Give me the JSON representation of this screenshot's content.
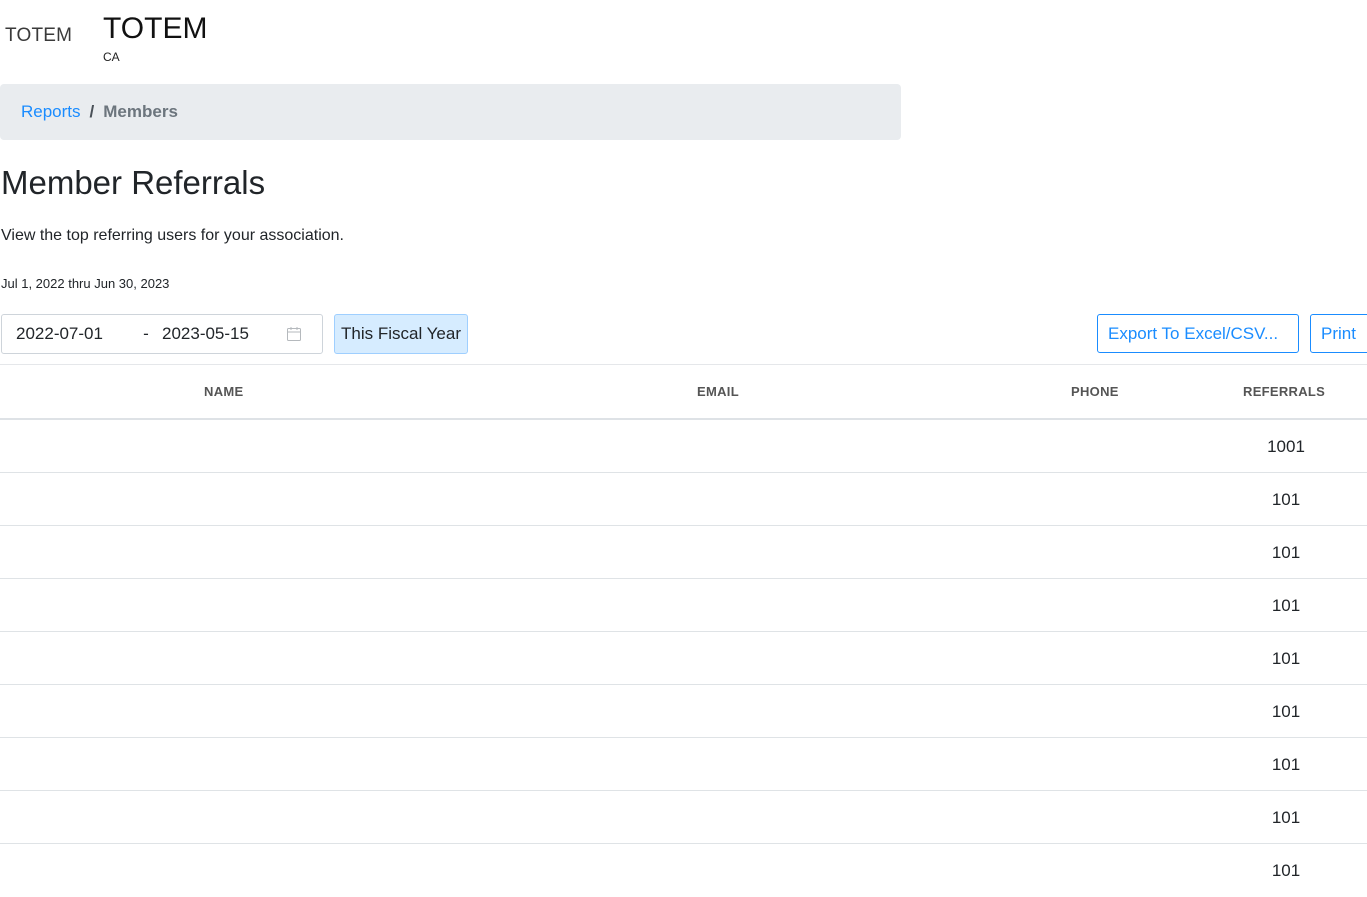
{
  "header": {
    "logo_text": "TOTEM",
    "org_name": "TOTEM",
    "org_sub": "CA"
  },
  "breadcrumb": {
    "link": "Reports",
    "separator": "/",
    "current": "Members"
  },
  "page": {
    "title": "Member Referrals",
    "description": "View the top referring users for your association.",
    "date_range_text": "Jul 1, 2022 thru Jun 30, 2023"
  },
  "date_picker": {
    "start": "2022-07-01",
    "separator": "-",
    "end": "2023-05-15",
    "icon": "calendar-icon"
  },
  "toolbar": {
    "fiscal_year": "This Fiscal Year",
    "export": "Export To Excel/CSV...",
    "print": "Print"
  },
  "table": {
    "headers": [
      "NAME",
      "EMAIL",
      "PHONE",
      "REFERRALS"
    ],
    "rows": [
      {
        "referrals": "1001"
      },
      {
        "referrals": "101"
      },
      {
        "referrals": "101"
      },
      {
        "referrals": "101"
      },
      {
        "referrals": "101"
      },
      {
        "referrals": "101"
      },
      {
        "referrals": "101"
      },
      {
        "referrals": "101"
      },
      {
        "referrals": "101"
      }
    ]
  },
  "colors": {
    "link": "#1a8cff",
    "breadcrumb_bg": "#e9ecef",
    "fiscal_bg": "#d6ecff"
  }
}
